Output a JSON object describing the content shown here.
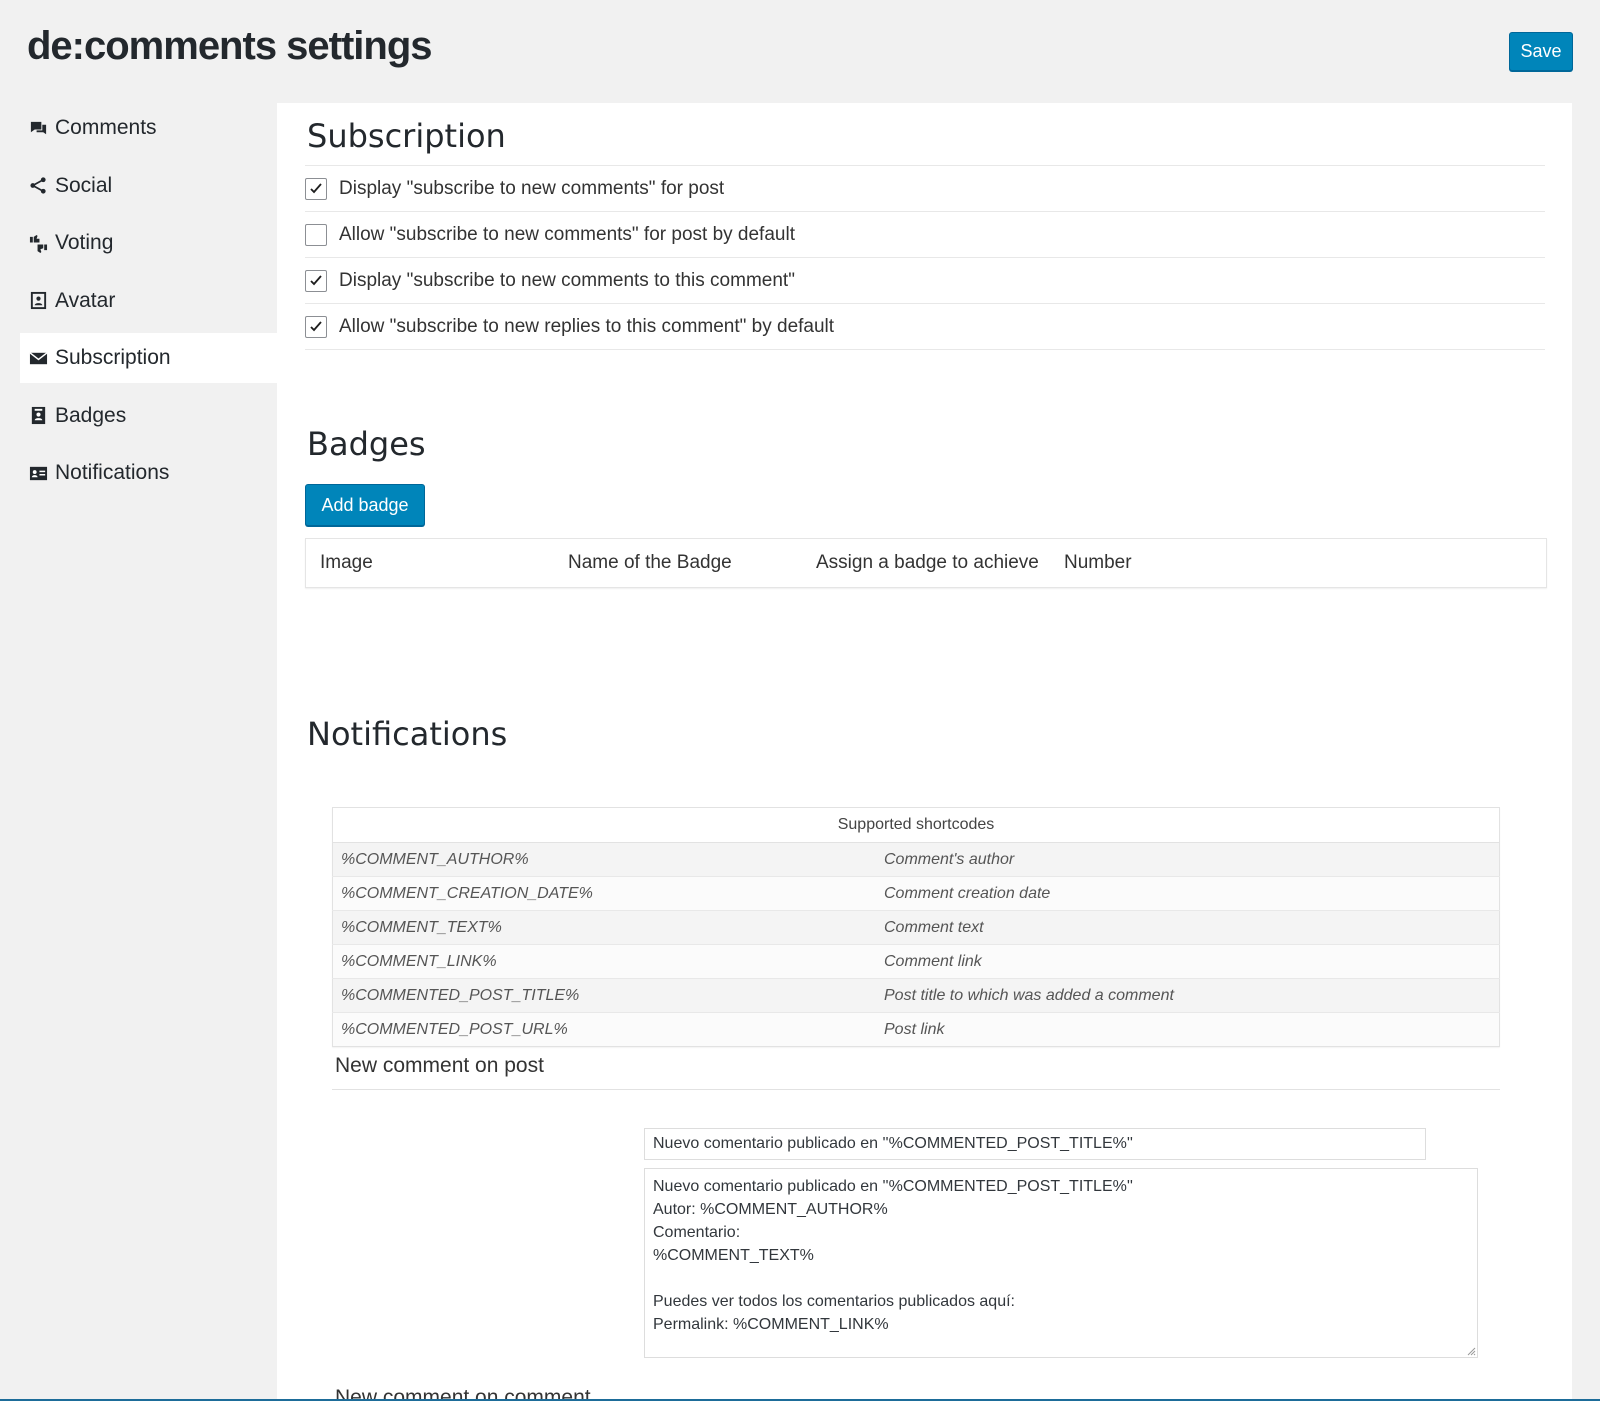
{
  "header": {
    "title": "de:comments settings",
    "save_label": "Save"
  },
  "sidebar": {
    "items": [
      {
        "label": "Comments",
        "icon": "comments-icon"
      },
      {
        "label": "Social",
        "icon": "share-icon"
      },
      {
        "label": "Voting",
        "icon": "thumbs-icon"
      },
      {
        "label": "Avatar",
        "icon": "id-card-icon"
      },
      {
        "label": "Subscription",
        "icon": "envelope-icon",
        "active": true
      },
      {
        "label": "Badges",
        "icon": "badge-icon"
      },
      {
        "label": "Notifications",
        "icon": "id-badge-icon"
      }
    ]
  },
  "subscription": {
    "title": "Subscription",
    "options": [
      {
        "label": "Display \"subscribe to new comments\" for post",
        "checked": true
      },
      {
        "label": "Allow \"subscribe to new comments\" for post by default",
        "checked": false
      },
      {
        "label": "Display \"subscribe to new comments to this comment\"",
        "checked": true
      },
      {
        "label": "Allow \"subscribe to new replies to this comment\" by default",
        "checked": true
      }
    ]
  },
  "badges": {
    "title": "Badges",
    "add_label": "Add badge",
    "columns": [
      "Image",
      "Name of the Badge",
      "Assign a badge to achieve",
      "Number"
    ]
  },
  "notifications": {
    "title": "Notifications",
    "shortcodes_header": "Supported shortcodes",
    "shortcodes": [
      {
        "code": "%COMMENT_AUTHOR%",
        "desc": "Comment's author"
      },
      {
        "code": "%COMMENT_CREATION_DATE%",
        "desc": "Comment creation date"
      },
      {
        "code": "%COMMENT_TEXT%",
        "desc": "Comment text"
      },
      {
        "code": "%COMMENT_LINK%",
        "desc": "Comment link"
      },
      {
        "code": "%COMMENTED_POST_TITLE%",
        "desc": "Post title to which was added a comment"
      },
      {
        "code": "%COMMENTED_POST_URL%",
        "desc": "Post link"
      }
    ],
    "new_comment_on_post": {
      "label": "New comment on post",
      "subject": "Nuevo comentario publicado en ''%COMMENTED_POST_TITLE%''",
      "body": "Nuevo comentario publicado en ''%COMMENTED_POST_TITLE%''\nAutor: %COMMENT_AUTHOR%\nComentario:\n%COMMENT_TEXT%\n\nPuedes ver todos los comentarios publicados aquí:\nPermalink: %COMMENT_LINK%"
    },
    "new_comment_on_comment": {
      "label": "New comment on comment"
    }
  },
  "colors": {
    "accent": "#0085ba",
    "background": "#f1f1f1"
  }
}
